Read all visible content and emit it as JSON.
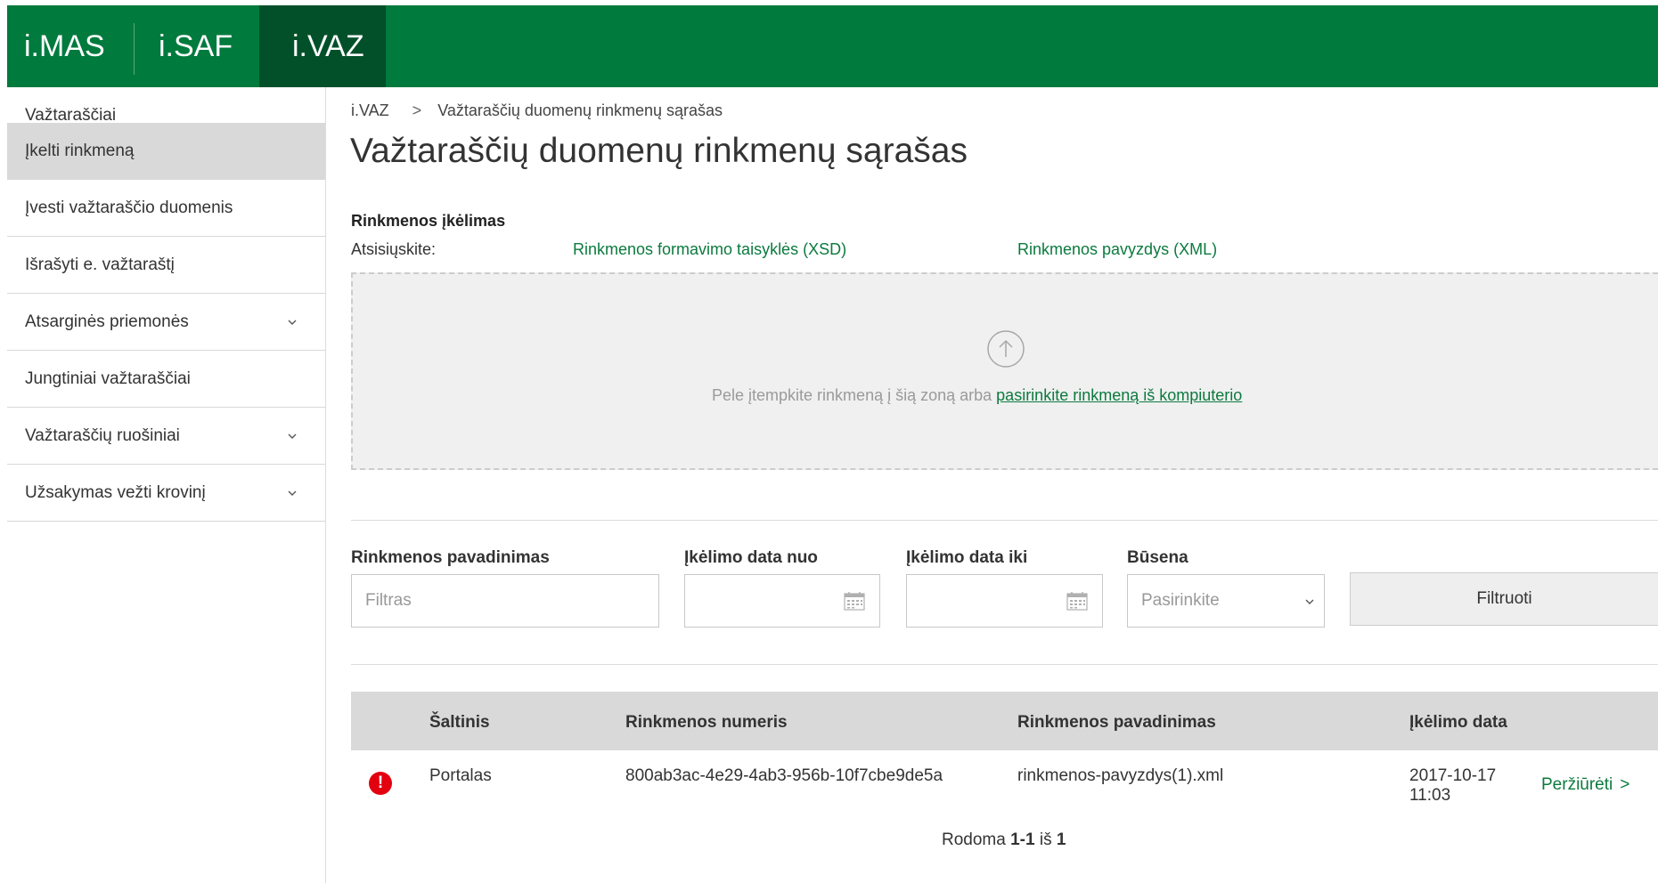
{
  "topbar": {
    "apps": [
      "i.MAS",
      "i.SAF",
      "i.VAZ"
    ],
    "active_app": "i.VAZ",
    "background": "#007a3d",
    "active_background": "#02502a"
  },
  "sidebar": {
    "items": [
      {
        "label": "Važtaraščiai",
        "active": false,
        "expandable": false
      },
      {
        "label": "Įkelti rinkmeną",
        "active": true,
        "expandable": false
      },
      {
        "label": "Įvesti važtaraščio duomenis",
        "active": false,
        "expandable": false
      },
      {
        "label": "Išrašyti e. važtaraštį",
        "active": false,
        "expandable": false
      },
      {
        "label": "Atsarginės priemonės",
        "active": false,
        "expandable": true
      },
      {
        "label": "Jungtiniai važtaraščiai",
        "active": false,
        "expandable": false
      },
      {
        "label": "Važtaraščių ruošiniai",
        "active": false,
        "expandable": true
      },
      {
        "label": "Užsakymas vežti krovinį",
        "active": false,
        "expandable": true
      }
    ]
  },
  "breadcrumb": {
    "root": "i.VAZ",
    "separator": ">",
    "current": "Važtaraščių duomenų rinkmenų sąrašas"
  },
  "page": {
    "title": "Važtaraščių duomenų rinkmenų sąrašas"
  },
  "upload": {
    "title": "Rinkmenos įkėlimas",
    "download_label": "Atsisiųskite:",
    "xsd_link": "Rinkmenos formavimo taisyklės (XSD)",
    "xml_link": "Rinkmenos pavyzdys (XML)",
    "drop_text": "Pele įtempkite rinkmeną į šią zoną arba",
    "drop_link": "pasirinkite rinkmeną iš kompiuterio",
    "icon": "upload-arrow-icon"
  },
  "filters": {
    "name_label": "Rinkmenos pavadinimas",
    "name_placeholder": "Filtras",
    "date_from_label": "Įkėlimo data nuo",
    "date_to_label": "Įkėlimo data iki",
    "status_label": "Būsena",
    "status_placeholder": "Pasirinkite",
    "button": "Filtruoti"
  },
  "table": {
    "columns": [
      "Šaltinis",
      "Rinkmenos numeris",
      "Rinkmenos pavadinimas",
      "Įkėlimo data"
    ],
    "rows": [
      {
        "status_icon": "error-icon",
        "status_symbol": "!",
        "source": "Portalas",
        "number": "800ab3ac-4e29-4ab3-956b-10f7cbe9de5a",
        "name": "rinkmenos-pavyzdys(1).xml",
        "date": "2017-10-17",
        "time": "11:03",
        "action": "Peržiūrėti",
        "action_arrow": ">"
      }
    ]
  },
  "pagination": {
    "prefix": "Rodoma",
    "range": "1-1",
    "of": "iš",
    "total": "1"
  },
  "colors": {
    "link": "#0b7a3e",
    "error": "#e3000f",
    "header_bg": "#d9d9d9"
  }
}
